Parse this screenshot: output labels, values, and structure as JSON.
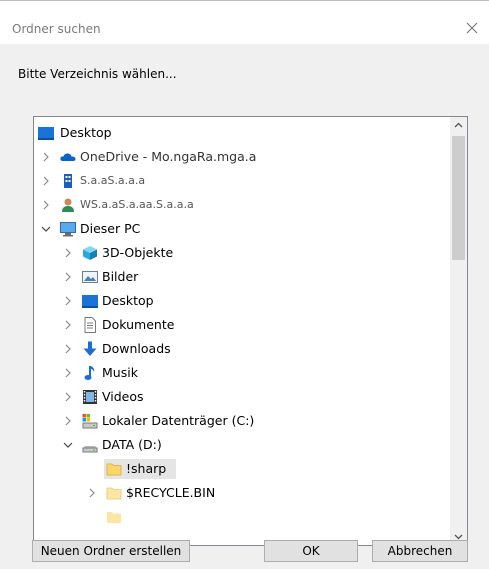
{
  "dialog": {
    "title": "Ordner suchen",
    "prompt": "Bitte Verzeichnis wählen..."
  },
  "tree": {
    "items": [
      {
        "label": "Desktop",
        "icon": "desktop-icon"
      },
      {
        "label": "OneDrive - Mo.ngaRa.mga.a",
        "icon": "onedrive-cloud-icon"
      },
      {
        "label": "S.a.aS.a.a.a",
        "icon": "building-icon"
      },
      {
        "label": "WS.a.aS.a.aa.S.a.a.a",
        "icon": "user-icon"
      },
      {
        "label": "Dieser PC",
        "icon": "computer-icon"
      },
      {
        "label": "3D-Objekte",
        "icon": "3d-objects-icon"
      },
      {
        "label": "Bilder",
        "icon": "pictures-icon"
      },
      {
        "label": "Desktop",
        "icon": "desktop-icon"
      },
      {
        "label": "Dokumente",
        "icon": "documents-icon"
      },
      {
        "label": "Downloads",
        "icon": "downloads-icon"
      },
      {
        "label": "Musik",
        "icon": "music-icon"
      },
      {
        "label": "Videos",
        "icon": "videos-icon"
      },
      {
        "label": "Lokaler Datenträger (C:)",
        "icon": "local-drive-icon"
      },
      {
        "label": "DATA (D:)",
        "icon": "data-drive-icon"
      },
      {
        "label": "!sharp",
        "icon": "folder-icon"
      },
      {
        "label": "$RECYCLE.BIN",
        "icon": "folder-icon"
      }
    ]
  },
  "buttons": {
    "new_folder": "Neuen Ordner erstellen",
    "ok": "OK",
    "cancel": "Abbrechen"
  },
  "colors": {
    "dialog_bg": "#f0f0f0",
    "selection": "#e5e5e5",
    "folder": "#fcd666"
  }
}
